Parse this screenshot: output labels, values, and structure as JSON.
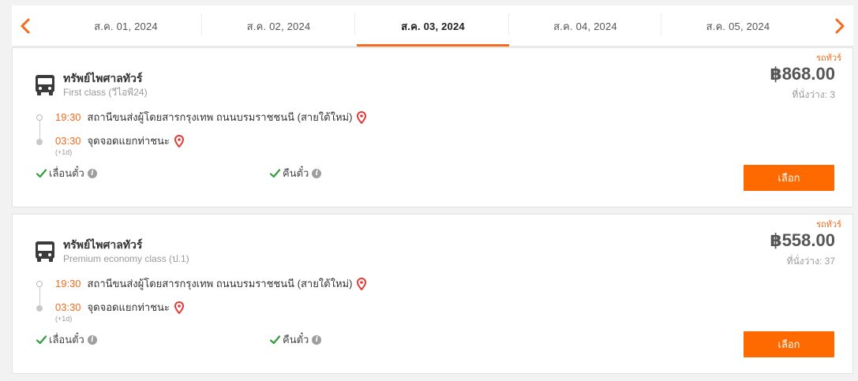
{
  "datebar": {
    "tabs": [
      {
        "label": "ส.ค. 01, 2024",
        "active": false
      },
      {
        "label": "ส.ค. 02, 2024",
        "active": false
      },
      {
        "label": "ส.ค. 03, 2024",
        "active": true
      },
      {
        "label": "ส.ค. 04, 2024",
        "active": false
      },
      {
        "label": "ส.ค. 05, 2024",
        "active": false
      }
    ],
    "prev_icon": "chevron-left-icon",
    "next_icon": "chevron-right-icon",
    "accent_color": "#f26a1b"
  },
  "trips": [
    {
      "tag": "รถทัวร์",
      "operator": "ทรัพย์ไพศาลทัวร์",
      "bus_class": "First class (วีไอพี24)",
      "price": "฿868.00",
      "seats": "ที่นั่งว่าง: 3",
      "departure_time": "19:30",
      "departure_stop": "สถานีขนส่งผู้โดยสารกรุงเทพ ถนนบรมราชชนนี (สายใต้ใหม่)",
      "arrival_time": "03:30",
      "arrival_stop": "จุดจอดแยกท่าชนะ",
      "next_day": "(+1d)",
      "feature_1": "เลื่อนตั๋ว",
      "feature_2": "คืนตั๋ว",
      "select_label": "เลือก"
    },
    {
      "tag": "รถทัวร์",
      "operator": "ทรัพย์ไพศาลทัวร์",
      "bus_class": "Premium economy class (ป.1)",
      "price": "฿558.00",
      "seats": "ที่นั่งว่าง: 37",
      "departure_time": "19:30",
      "departure_stop": "สถานีขนส่งผู้โดยสารกรุงเทพ ถนนบรมราชชนนี (สายใต้ใหม่)",
      "arrival_time": "03:30",
      "arrival_stop": "จุดจอดแยกท่าชนะ",
      "next_day": "(+1d)",
      "feature_1": "เลื่อนตั๋ว",
      "feature_2": "คืนตั๋ว",
      "select_label": "เลือก"
    }
  ],
  "colors": {
    "accent": "#f26a1b",
    "button": "#ff6a00",
    "check": "#2e9e3a",
    "pin": "#e53935"
  }
}
